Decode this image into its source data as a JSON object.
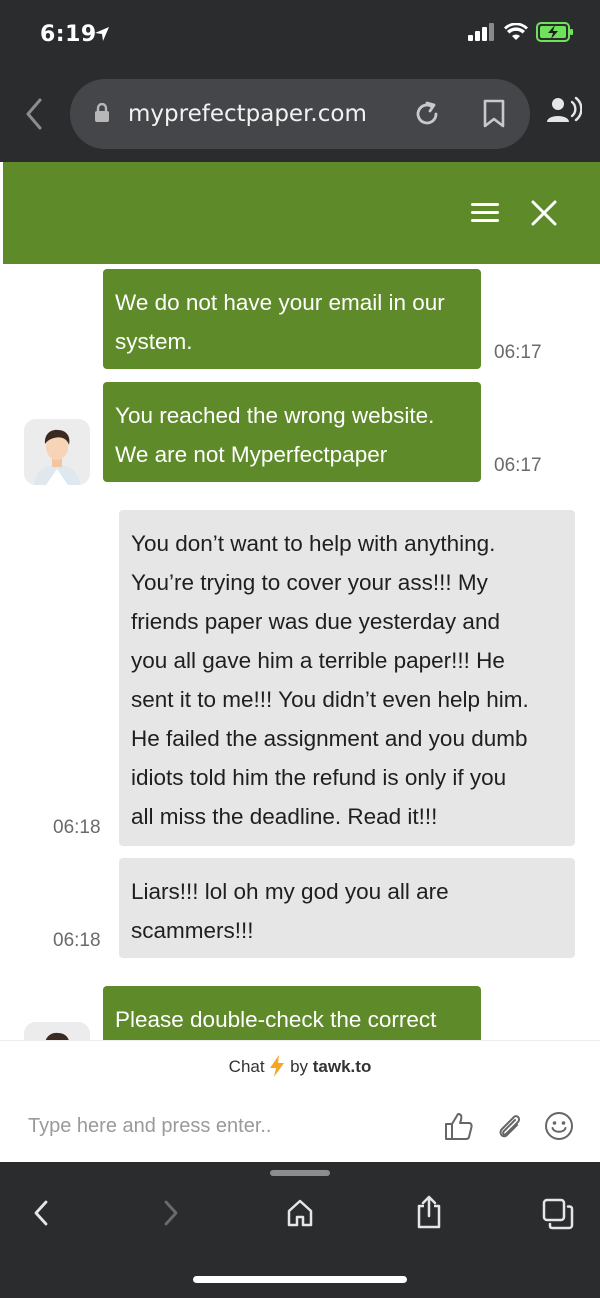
{
  "status": {
    "time": "6:19"
  },
  "browser": {
    "url": "myprefectpaper.com"
  },
  "messages": [
    {
      "from": "agent",
      "lines": [
        "We do not have your email in our",
        "system."
      ],
      "time": "06:17"
    },
    {
      "from": "agent",
      "lines": [
        "You reached the wrong website.",
        "We are not Myperfectpaper"
      ],
      "time": "06:17"
    },
    {
      "from": "visitor",
      "lines": [
        "You don’t want to help with anything.",
        "You’re trying to cover your ass!!! My",
        "friends paper was due yesterday and",
        "you all gave him a terrible paper!!! He",
        "sent it to me!!! You didn’t even help him.",
        "He failed the assignment and you dumb",
        "idiots told him the refund is only if you",
        "all miss the deadline. Read it!!!"
      ],
      "time": "06:18"
    },
    {
      "from": "visitor",
      "lines": [
        "Liars!!! lol oh my god you all are",
        "scammers!!!"
      ],
      "time": "06:18"
    },
    {
      "from": "agent",
      "lines": [
        "Please double-check the correct"
      ],
      "time": ""
    }
  ],
  "footer": {
    "powered_chat": "Chat",
    "powered_by": "by",
    "powered_brand": "tawk.to",
    "input_placeholder": "Type here and press enter.."
  },
  "colors": {
    "agent_bubble": "#5e8a29",
    "visitor_bubble": "#e6e6e6",
    "chrome": "#2b2c2e"
  },
  "icons": [
    "location-arrow-icon",
    "signal-icon",
    "wifi-icon",
    "battery-charging-icon",
    "back-icon",
    "lock-icon",
    "reload-icon",
    "bookmark-icon",
    "reader-icon",
    "menu-icon",
    "close-icon",
    "lightning-icon",
    "thumbs-up-icon",
    "paperclip-icon",
    "emoji-icon",
    "forward-icon",
    "home-icon",
    "share-icon",
    "tabs-icon"
  ]
}
